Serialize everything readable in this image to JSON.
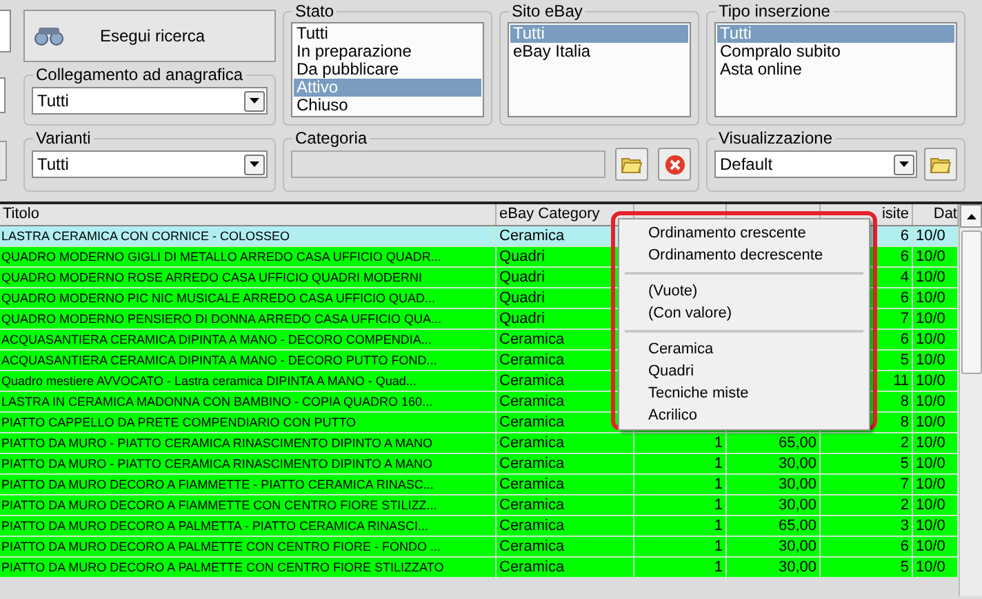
{
  "search_button": {
    "label": "Esegui ricerca"
  },
  "stato": {
    "label": "Stato",
    "items": [
      {
        "text": "Tutti",
        "selected": false
      },
      {
        "text": "In preparazione",
        "selected": false
      },
      {
        "text": "Da pubblicare",
        "selected": false
      },
      {
        "text": "Attivo",
        "selected": true
      },
      {
        "text": "Chiuso",
        "selected": false
      }
    ]
  },
  "sito_ebay": {
    "label": "Sito eBay",
    "items": [
      {
        "text": "Tutti",
        "selected": true
      },
      {
        "text": "eBay Italia",
        "selected": false
      }
    ]
  },
  "tipo_inserzione": {
    "label": "Tipo inserzione",
    "items": [
      {
        "text": "Tutti",
        "selected": true
      },
      {
        "text": "Compralo subito",
        "selected": false
      },
      {
        "text": "Asta online",
        "selected": false
      }
    ]
  },
  "collegamento": {
    "label": "Collegamento ad anagrafica",
    "value": "Tutti"
  },
  "varianti": {
    "label": "Varianti",
    "value": "Tutti"
  },
  "categoria": {
    "label": "Categoria"
  },
  "visualizzazione": {
    "label": "Visualizzazione",
    "value": "Default"
  },
  "table": {
    "columns": [
      "Titolo",
      "eBay Category",
      null,
      null,
      "isite",
      "Dat"
    ],
    "rows": [
      {
        "selected": true,
        "cells": [
          "LASTRA CERAMICA CON CORNICE - COLOSSEO",
          "Ceramica",
          null,
          null,
          "6",
          "10/0"
        ]
      },
      {
        "selected": false,
        "cells": [
          "QUADRO MODERNO GIGLI DI METALLO ARREDO CASA UFFICIO QUADR...",
          "Quadri",
          null,
          null,
          "6",
          "10/0"
        ]
      },
      {
        "selected": false,
        "cells": [
          "QUADRO MODERNO ROSE ARREDO CASA UFFICIO QUADRI MODERNI",
          "Quadri",
          null,
          null,
          "4",
          "10/0"
        ]
      },
      {
        "selected": false,
        "cells": [
          "QUADRO MODERNO PIC NIC MUSICALE ARREDO CASA UFFICIO QUAD...",
          "Quadri",
          null,
          null,
          "6",
          "10/0"
        ]
      },
      {
        "selected": false,
        "cells": [
          "QUADRO MODERNO PENSIERO DI DONNA ARREDO CASA UFFICIO QUA...",
          "Quadri",
          null,
          null,
          "7",
          "10/0"
        ]
      },
      {
        "selected": false,
        "cells": [
          "ACQUASANTIERA CERAMICA DIPINTA A MANO - DECORO COMPENDIA...",
          "Ceramica",
          null,
          null,
          "6",
          "10/0"
        ]
      },
      {
        "selected": false,
        "cells": [
          "ACQUASANTIERA CERAMICA DIPINTA A MANO - DECORO PUTTO FOND...",
          "Ceramica",
          null,
          null,
          "5",
          "10/0"
        ]
      },
      {
        "selected": false,
        "cells": [
          "Quadro mestiere AVVOCATO - Lastra ceramica DIPINTA A MANO - Quad...",
          "Ceramica",
          null,
          null,
          "11",
          "10/0"
        ]
      },
      {
        "selected": false,
        "cells": [
          "LASTRA IN CERAMICA MADONNA CON BAMBINO - COPIA QUADRO 160...",
          "Ceramica",
          null,
          null,
          "8",
          "10/0"
        ]
      },
      {
        "selected": false,
        "cells": [
          "PIATTO CAPPELLO DA PRETE COMPENDIARIO CON PUTTO",
          "Ceramica",
          null,
          null,
          "8",
          "10/0"
        ]
      },
      {
        "selected": false,
        "cells": [
          "PIATTO DA MURO - PIATTO CERAMICA RINASCIMENTO DIPINTO A MANO",
          "Ceramica",
          "1",
          "65,00",
          "2",
          "10/0"
        ]
      },
      {
        "selected": false,
        "cells": [
          "PIATTO DA MURO - PIATTO CERAMICA RINASCIMENTO DIPINTO A MANO",
          "Ceramica",
          "1",
          "30,00",
          "5",
          "10/0"
        ]
      },
      {
        "selected": false,
        "cells": [
          "PIATTO DA MURO DECORO A FIAMMETTE - PIATTO CERAMICA RINASC...",
          "Ceramica",
          "1",
          "30,00",
          "7",
          "10/0"
        ]
      },
      {
        "selected": false,
        "cells": [
          "PIATTO DA MURO DECORO A FIAMMETTE CON CENTRO FIORE STILIZZ...",
          "Ceramica",
          "1",
          "30,00",
          "2",
          "10/0"
        ]
      },
      {
        "selected": false,
        "cells": [
          "PIATTO DA MURO DECORO A PALMETTA - PIATTO CERAMICA RINASCI...",
          "Ceramica",
          "1",
          "65,00",
          "3",
          "10/0"
        ]
      },
      {
        "selected": false,
        "cells": [
          "PIATTO DA MURO DECORO A PALMETTE CON CENTRO FIORE - FONDO ...",
          "Ceramica",
          "1",
          "30,00",
          "6",
          "10/0"
        ]
      },
      {
        "selected": false,
        "cells": [
          "PIATTO DA MURO DECORO A PALMETTE CON CENTRO FIORE STILIZZATO",
          "Ceramica",
          "1",
          "30,00",
          "5",
          "10/0"
        ]
      }
    ]
  },
  "context_menu": {
    "sections": [
      [
        "Ordinamento crescente",
        "Ordinamento decrescente"
      ],
      [
        "(Vuote)",
        "(Con valore)"
      ],
      [
        "Ceramica",
        "Quadri",
        "Tecniche miste",
        "Acrilico"
      ]
    ]
  }
}
